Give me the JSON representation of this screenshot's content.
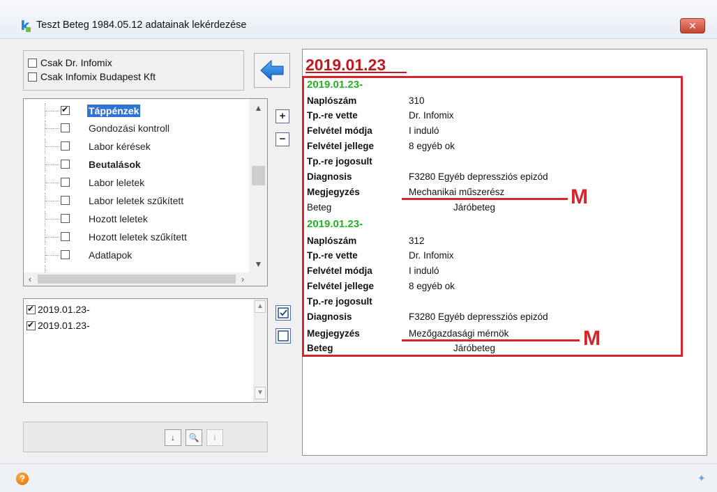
{
  "window": {
    "title": "Teszt Beteg 1984.05.12 adatainak lekérdezése",
    "close_label": "✕"
  },
  "filters": {
    "only_doctor": "Csak Dr. Infomix",
    "only_company": "Csak Infomix Budapest Kft"
  },
  "tree": {
    "items": [
      {
        "label": "Táppénzek",
        "checked": true,
        "selected": true
      },
      {
        "label": "Gondozási kontroll",
        "checked": false
      },
      {
        "label": "Labor kérések",
        "checked": false
      },
      {
        "label": "Beutalások",
        "checked": false,
        "bold": true
      },
      {
        "label": "Labor leletek",
        "checked": false
      },
      {
        "label": "Labor leletek szűkített",
        "checked": false
      },
      {
        "label": "Hozott leletek",
        "checked": false
      },
      {
        "label": "Hozott leletek szűkített",
        "checked": false
      },
      {
        "label": "Adatlapok",
        "checked": false
      }
    ],
    "expand_label": "+",
    "collapse_label": "−"
  },
  "list": {
    "items": [
      {
        "label": "2019.01.23-",
        "checked": true
      },
      {
        "label": "2019.01.23-",
        "checked": true
      }
    ]
  },
  "report": {
    "header_date": "2019.01.23",
    "records": [
      {
        "date": "2019.01.23-",
        "fields": [
          {
            "key": "Naplószám",
            "value": "310"
          },
          {
            "key": "Tp.-re vette",
            "value": "Dr. Infomix"
          },
          {
            "key": "Felvétel módja",
            "value": "I induló"
          },
          {
            "key": "Felvétel jellege",
            "value": "8 egyéb ok"
          },
          {
            "key": "Tp.-re  jogosult",
            "value": ""
          },
          {
            "key": "Diagnosis",
            "value": "F3280  Egyéb depressziós epizód"
          },
          {
            "key": "Megjegyzés",
            "value": "Mechanikai műszerész"
          },
          {
            "key": "Beteg",
            "value": "Járóbeteg"
          }
        ]
      },
      {
        "date": "2019.01.23-",
        "fields": [
          {
            "key": "Naplószám",
            "value": "312"
          },
          {
            "key": "Tp.-re vette",
            "value": "Dr. Infomix"
          },
          {
            "key": "Felvétel módja",
            "value": "I induló"
          },
          {
            "key": "Felvétel jellege",
            "value": "8 egyéb ok"
          },
          {
            "key": "Tp.-re  jogosult",
            "value": ""
          },
          {
            "key": "Diagnosis",
            "value": "F3280  Egyéb depressziós epizód"
          },
          {
            "key": "Megjegyzés",
            "value": "Mezőgazdasági mérnök"
          },
          {
            "key": "Beteg",
            "value": "Járóbeteg"
          }
        ]
      }
    ],
    "annotation_letter": "M"
  },
  "toolbar": {
    "sort_label": "↓",
    "preview_label": "🔍",
    "info_label": "i"
  },
  "colors": {
    "accent_red": "#d7262b",
    "record_date_green": "#22b322",
    "selection_blue": "#3173d1"
  }
}
